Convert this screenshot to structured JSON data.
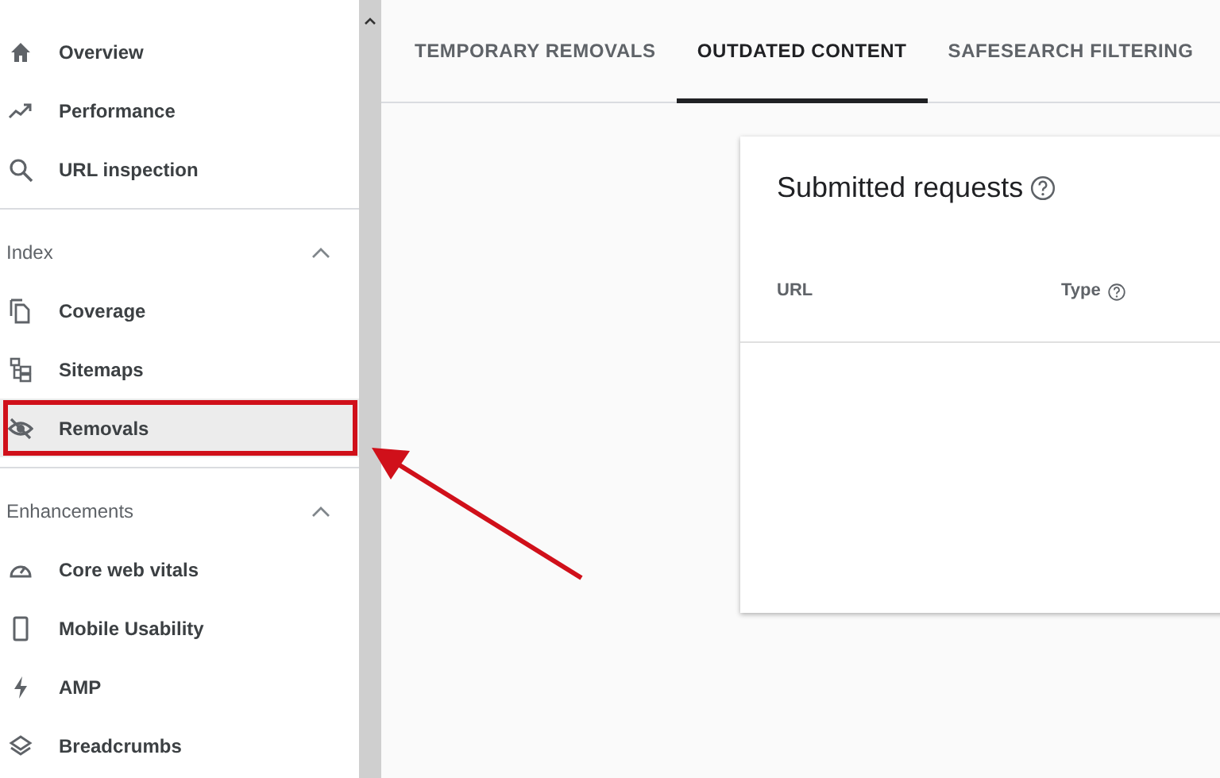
{
  "sidebar": {
    "sections": [
      {
        "items": [
          {
            "label": "Overview",
            "selected": false,
            "highlighted": false
          },
          {
            "label": "Performance",
            "selected": false,
            "highlighted": false
          },
          {
            "label": "URL inspection",
            "selected": false,
            "highlighted": false
          }
        ]
      },
      {
        "title": "Index",
        "expanded": true,
        "items": [
          {
            "label": "Coverage",
            "selected": false,
            "highlighted": false
          },
          {
            "label": "Sitemaps",
            "selected": false,
            "highlighted": false
          },
          {
            "label": "Removals",
            "selected": true,
            "highlighted": true
          }
        ]
      },
      {
        "title": "Enhancements",
        "expanded": true,
        "items": [
          {
            "label": "Core web vitals",
            "selected": false,
            "highlighted": false
          },
          {
            "label": "Mobile Usability",
            "selected": false,
            "highlighted": false
          },
          {
            "label": "AMP",
            "selected": false,
            "highlighted": false
          },
          {
            "label": "Breadcrumbs",
            "selected": false,
            "highlighted": false
          }
        ]
      }
    ]
  },
  "tabs": [
    {
      "label": "TEMPORARY REMOVALS",
      "selected": false
    },
    {
      "label": "OUTDATED CONTENT",
      "selected": true
    },
    {
      "label": "SAFESEARCH FILTERING",
      "selected": false
    }
  ],
  "card": {
    "title": "Submitted requests",
    "columns": [
      {
        "label": "URL",
        "help": false
      },
      {
        "label": "Type",
        "help": true
      }
    ]
  }
}
